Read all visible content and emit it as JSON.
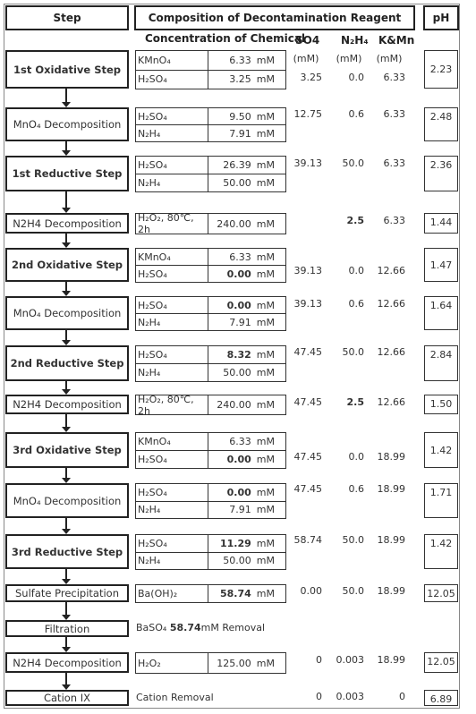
{
  "header": {
    "step": "Step",
    "composition": "Composition of Decontamination Reagent",
    "ph": "pH"
  },
  "subheader": {
    "concentration": "Concentration of Chemical",
    "so4": "SO4",
    "n2h4": "N₂H₄",
    "kmn": "K&Mn",
    "unit": "(mM)"
  },
  "rows": [
    {
      "step": "1st Oxidative Step",
      "bold": true,
      "chemicals": [
        {
          "name": "KMnO₄",
          "value": "6.33",
          "unit": "mM"
        },
        {
          "name": "H₂SO₄",
          "value": "3.25",
          "unit": "mM"
        }
      ],
      "so4": "3.25",
      "n2h4": "0.0",
      "kmn": "6.33",
      "ph": "2.23"
    },
    {
      "step": "MnO₄ Decomposition",
      "bold": false,
      "chemicals": [
        {
          "name": "H₂SO₄",
          "value": "9.50",
          "unit": "mM"
        },
        {
          "name": "N₂H₄",
          "value": "7.91",
          "unit": "mM"
        }
      ],
      "so4": "12.75",
      "n2h4": "0.6",
      "kmn": "6.33",
      "ph": "2.48"
    },
    {
      "step": "1st Reductive Step",
      "bold": true,
      "chemicals": [
        {
          "name": "H₂SO₄",
          "value": "26.39",
          "unit": "mM"
        },
        {
          "name": "N₂H₄",
          "value": "50.00",
          "unit": "mM"
        }
      ],
      "so4": "39.13",
      "n2h4": "50.0",
      "kmn": "6.33",
      "ph": "2.36"
    },
    {
      "step": "N2H4 Decomposition",
      "bold": false,
      "chemicals": [
        {
          "name": "H₂O₂, 80℃, 2h",
          "value": "240.00",
          "unit": "mM"
        }
      ],
      "so4": "",
      "n2h4": "2.5",
      "n2h4_bold": true,
      "kmn": "6.33",
      "ph": "1.44"
    },
    {
      "step": "2nd Oxidative Step",
      "bold": true,
      "chemicals": [
        {
          "name": "KMnO₄",
          "value": "6.33",
          "unit": "mM"
        },
        {
          "name": "H₂SO₄",
          "value": "0.00",
          "unit": "mM",
          "bold": true
        }
      ],
      "so4": "39.13",
      "n2h4": "0.0",
      "kmn": "12.66",
      "ph": "1.47"
    },
    {
      "step": "MnO₄ Decomposition",
      "bold": false,
      "chemicals": [
        {
          "name": "H₂SO₄",
          "value": "0.00",
          "unit": "mM",
          "bold": true
        },
        {
          "name": "N₂H₄",
          "value": "7.91",
          "unit": "mM"
        }
      ],
      "so4": "39.13",
      "n2h4": "0.6",
      "kmn": "12.66",
      "ph": "1.64"
    },
    {
      "step": "2nd Reductive Step",
      "bold": true,
      "chemicals": [
        {
          "name": "H₂SO₄",
          "value": "8.32",
          "unit": "mM",
          "bold": true
        },
        {
          "name": "N₂H₄",
          "value": "50.00",
          "unit": "mM"
        }
      ],
      "so4": "47.45",
      "n2h4": "50.0",
      "kmn": "12.66",
      "ph": "2.84"
    },
    {
      "step": "N2H4 Decomposition",
      "bold": false,
      "chemicals": [
        {
          "name": "H₂O₂, 80℃, 2h",
          "value": "240.00",
          "unit": "mM"
        }
      ],
      "so4": "47.45",
      "n2h4": "2.5",
      "n2h4_bold": true,
      "kmn": "12.66",
      "ph": "1.50"
    },
    {
      "step": "3rd Oxidative Step",
      "bold": true,
      "chemicals": [
        {
          "name": "KMnO₄",
          "value": "6.33",
          "unit": "mM"
        },
        {
          "name": "H₂SO₄",
          "value": "0.00",
          "unit": "mM",
          "bold": true
        }
      ],
      "so4": "47.45",
      "n2h4": "0.0",
      "kmn": "18.99",
      "ph": "1.42"
    },
    {
      "step": "MnO₄ Decomposition",
      "bold": false,
      "chemicals": [
        {
          "name": "H₂SO₄",
          "value": "0.00",
          "unit": "mM",
          "bold": true
        },
        {
          "name": "N₂H₄",
          "value": "7.91",
          "unit": "mM"
        }
      ],
      "so4": "47.45",
      "n2h4": "0.6",
      "kmn": "18.99",
      "ph": "1.71"
    },
    {
      "step": "3rd Reductive Step",
      "bold": true,
      "chemicals": [
        {
          "name": "H₂SO₄",
          "value": "11.29",
          "unit": "mM",
          "bold": true
        },
        {
          "name": "N₂H₄",
          "value": "50.00",
          "unit": "mM"
        }
      ],
      "so4": "58.74",
      "n2h4": "50.0",
      "kmn": "18.99",
      "ph": "1.42"
    },
    {
      "step": "Sulfate Precipitation",
      "bold": false,
      "chemicals": [
        {
          "name": "Ba(OH)₂",
          "value": "58.74",
          "unit": "mM",
          "bold": true
        }
      ],
      "so4": "0.00",
      "n2h4": "50.0",
      "kmn": "18.99",
      "ph": "12.05"
    },
    {
      "step": "Filtration",
      "bold": false,
      "note": {
        "prefix": "BaSO₄ ",
        "bold": "58.74",
        "suffix": "mM Removal"
      },
      "so4": "",
      "n2h4": "",
      "kmn": "",
      "ph": ""
    },
    {
      "step": "N2H4 Decomposition",
      "bold": false,
      "chemicals": [
        {
          "name": "H₂O₂",
          "value": "125.00",
          "unit": "mM"
        }
      ],
      "so4": "0",
      "n2h4": "0.003",
      "kmn": "18.99",
      "ph": "12.05"
    },
    {
      "step": "Cation IX",
      "bold": false,
      "note": {
        "prefix": "Cation Removal",
        "bold": "",
        "suffix": ""
      },
      "so4": "0",
      "n2h4": "0.003",
      "kmn": "0",
      "ph": "6.89"
    }
  ]
}
